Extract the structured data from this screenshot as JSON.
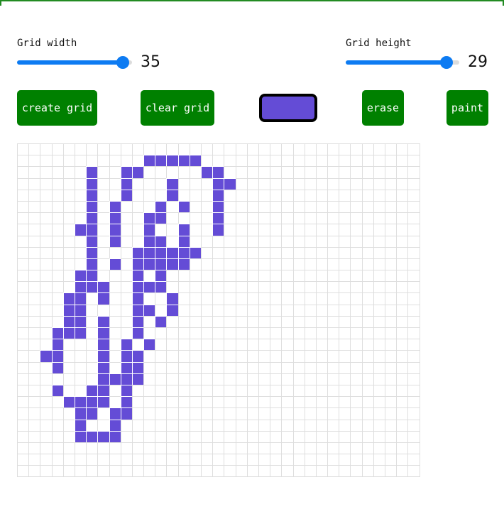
{
  "controls": {
    "grid_width": {
      "label": "Grid width",
      "value": 35,
      "min": 1,
      "max": 36
    },
    "grid_height": {
      "label": "Grid height",
      "value": 29,
      "min": 1,
      "max": 31
    }
  },
  "buttons": {
    "create": "create grid",
    "clear": "clear grid",
    "erase": "erase",
    "paint": "paint"
  },
  "colors": {
    "paint": "#644cd6",
    "button_bg": "#008000",
    "slider": "#0d7bf2",
    "grid_line": "#dedede"
  },
  "grid": {
    "painted_rows": [
      [],
      [
        11,
        12,
        13,
        14,
        15
      ],
      [
        6,
        9,
        10,
        16,
        17
      ],
      [
        6,
        9,
        13,
        17,
        18
      ],
      [
        6,
        9,
        13,
        17
      ],
      [
        6,
        8,
        12,
        14,
        17
      ],
      [
        6,
        8,
        11,
        12,
        17
      ],
      [
        5,
        6,
        8,
        11,
        14,
        17
      ],
      [
        6,
        8,
        11,
        12,
        14
      ],
      [
        6,
        10,
        11,
        12,
        13,
        14,
        15
      ],
      [
        6,
        8,
        10,
        11,
        12,
        13,
        14
      ],
      [
        5,
        6,
        10,
        12
      ],
      [
        5,
        6,
        7,
        10,
        11,
        12
      ],
      [
        4,
        5,
        7,
        10,
        13
      ],
      [
        4,
        5,
        10,
        11,
        13
      ],
      [
        4,
        5,
        7,
        10,
        12
      ],
      [
        3,
        4,
        5,
        7,
        10
      ],
      [
        3,
        7,
        9,
        11
      ],
      [
        2,
        3,
        7,
        9,
        10
      ],
      [
        3,
        7,
        9,
        10
      ],
      [
        7,
        8,
        9,
        10
      ],
      [
        3,
        6,
        7,
        9
      ],
      [
        4,
        5,
        6,
        7,
        9
      ],
      [
        5,
        6,
        8,
        9
      ],
      [
        5,
        8
      ],
      [
        5,
        6,
        7,
        8
      ]
    ]
  }
}
